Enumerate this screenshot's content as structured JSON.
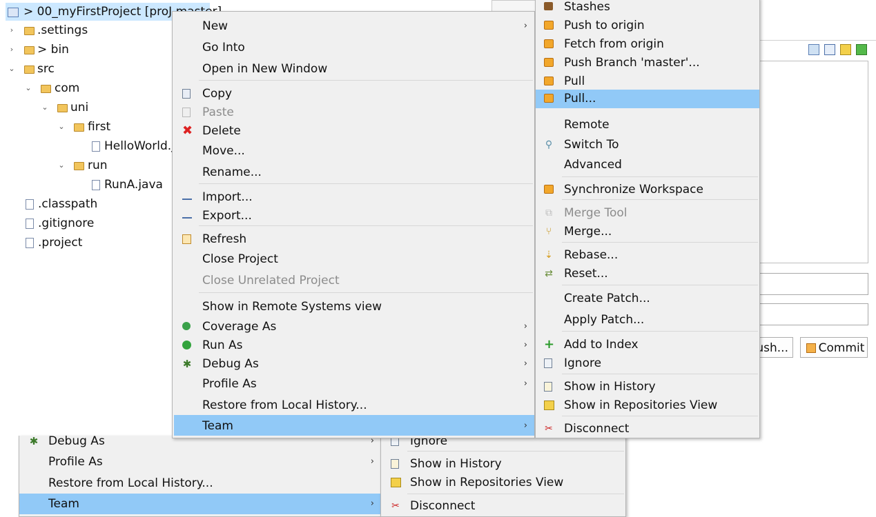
{
  "tree": {
    "project": "> 00_myFirstProject [proJ master]",
    "items": [
      {
        "label": ".settings"
      },
      {
        "label": "> bin"
      },
      {
        "label": "src"
      },
      {
        "label": "com"
      },
      {
        "label": "uni"
      },
      {
        "label": "first"
      },
      {
        "label": "HelloWorld.j"
      },
      {
        "label": "run"
      },
      {
        "label": "RunA.java"
      },
      {
        "label": ".classpath"
      },
      {
        "label": ".gitignore"
      },
      {
        "label": ".project"
      }
    ]
  },
  "context_menu": {
    "items": [
      {
        "label": "New"
      },
      {
        "label": "Go Into"
      },
      {
        "label": "Open in New Window"
      },
      {
        "label": "Copy"
      },
      {
        "label": "Paste"
      },
      {
        "label": "Delete"
      },
      {
        "label": "Move..."
      },
      {
        "label": "Rename..."
      },
      {
        "label": "Import..."
      },
      {
        "label": "Export..."
      },
      {
        "label": "Refresh"
      },
      {
        "label": "Close Project"
      },
      {
        "label": "Close Unrelated Project"
      },
      {
        "label": "Show in Remote Systems view"
      },
      {
        "label": "Coverage As"
      },
      {
        "label": "Run As"
      },
      {
        "label": "Debug As"
      },
      {
        "label": "Profile As"
      },
      {
        "label": "Restore from Local History..."
      },
      {
        "label": "Team"
      }
    ]
  },
  "team_menu": {
    "items": [
      {
        "label": "Stashes"
      },
      {
        "label": "Push to origin"
      },
      {
        "label": "Fetch from origin"
      },
      {
        "label": "Push Branch 'master'..."
      },
      {
        "label": "Pull"
      },
      {
        "label": "Pull..."
      },
      {
        "label": "Remote"
      },
      {
        "label": "Switch To"
      },
      {
        "label": "Advanced"
      },
      {
        "label": "Synchronize Workspace"
      },
      {
        "label": "Merge Tool"
      },
      {
        "label": "Merge..."
      },
      {
        "label": "Rebase..."
      },
      {
        "label": "Reset..."
      },
      {
        "label": "Create Patch..."
      },
      {
        "label": "Apply Patch..."
      },
      {
        "label": "Add to Index"
      },
      {
        "label": "Ignore"
      },
      {
        "label": "Show in History"
      },
      {
        "label": "Show in Repositories View"
      },
      {
        "label": "Disconnect"
      }
    ]
  },
  "ghost_menu": {
    "items": [
      {
        "label": "Debug As"
      },
      {
        "label": "Profile As"
      },
      {
        "label": "Restore from Local History..."
      },
      {
        "label": "Team"
      }
    ]
  },
  "ghost_team_menu": {
    "items": [
      {
        "label": "Ignore"
      },
      {
        "label": "Show in History"
      },
      {
        "label": "Show in Repositories View"
      },
      {
        "label": "Disconnect"
      }
    ]
  },
  "staging": {
    "push_label": "Push...",
    "commit_label": "Commit"
  },
  "colors": {
    "highlight": "#91c9f7",
    "menu_bg": "#f0f0f0",
    "selection": "#cce8ff"
  }
}
